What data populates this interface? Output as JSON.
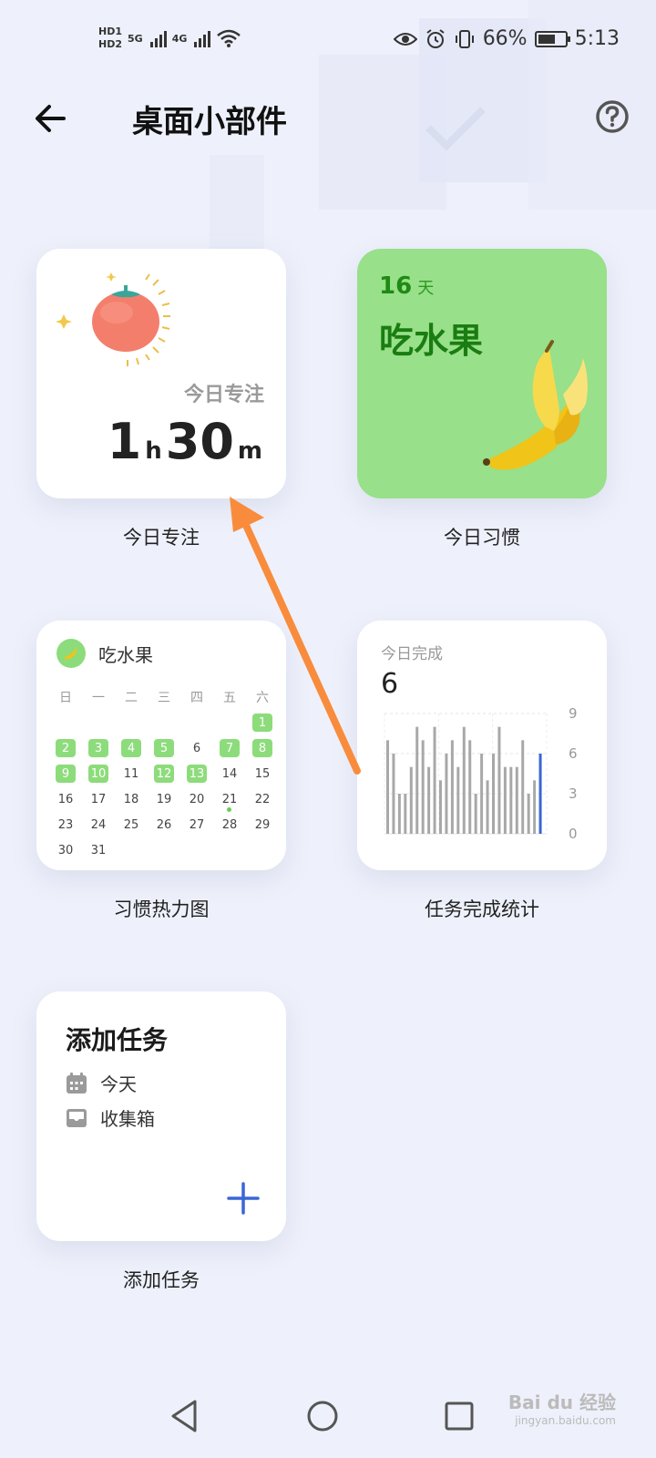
{
  "status_bar": {
    "hd1": "HD1",
    "hd2": "HD2",
    "net1": "5G",
    "net2": "4G",
    "battery_pct": "66%",
    "battery_level": 0.66,
    "time": "5:13",
    "icons": [
      "eye-icon",
      "alarm-icon",
      "vibrate-icon",
      "wifi-icon"
    ]
  },
  "header": {
    "title": "桌面小部件",
    "back_icon": "back-arrow-icon",
    "help_icon": "help-circle-icon"
  },
  "widgets": {
    "focus": {
      "label": "今日专注",
      "hours": "1",
      "hours_unit": "h",
      "minutes": "30",
      "minutes_unit": "m",
      "caption": "今日专注",
      "icon": "tomato-icon"
    },
    "habit": {
      "days": "16",
      "days_unit": "天",
      "name": "吃水果",
      "caption": "今日习惯",
      "icon": "banana-icon",
      "bg_color": "#98e089"
    },
    "heatmap": {
      "title": "吃水果",
      "caption": "习惯热力图",
      "weekdays": [
        "日",
        "一",
        "二",
        "三",
        "四",
        "五",
        "六"
      ],
      "weeks": [
        [
          "",
          "",
          "",
          "",
          "",
          "",
          "1"
        ],
        [
          "2",
          "3",
          "4",
          "5",
          "6",
          "7",
          "8"
        ],
        [
          "9",
          "10",
          "11",
          "12",
          "13",
          "14",
          "15"
        ],
        [
          "16",
          "17",
          "18",
          "19",
          "20",
          "21",
          "22"
        ],
        [
          "23",
          "24",
          "25",
          "26",
          "27",
          "28",
          "29"
        ],
        [
          "30",
          "31",
          "",
          "",
          "",
          "",
          ""
        ]
      ],
      "completed_days": [
        "1",
        "2",
        "3",
        "4",
        "5",
        "7",
        "8",
        "9",
        "10",
        "12",
        "13"
      ],
      "today": "21"
    },
    "stats": {
      "label": "今日完成",
      "value": "6",
      "caption": "任务完成统计",
      "y_ticks": [
        "9",
        "6",
        "3",
        "0"
      ]
    },
    "add_task": {
      "title": "添加任务",
      "items": [
        {
          "label": "今天",
          "icon": "calendar-icon"
        },
        {
          "label": "收集箱",
          "icon": "inbox-icon"
        }
      ],
      "caption": "添加任务",
      "plus_icon": "plus-icon"
    }
  },
  "watermark": {
    "text": "Bai du 经验",
    "sub": "jingyan.baidu.com"
  },
  "colors": {
    "accent_blue": "#3a66d6",
    "habit_green": "#98e089",
    "arrow_orange": "#f88c3c"
  },
  "chart_data": {
    "type": "bar",
    "title": "今日完成",
    "ylim": [
      0,
      9
    ],
    "y_ticks": [
      0,
      3,
      6,
      9
    ],
    "grid": true,
    "series": [
      {
        "values": [
          7,
          6,
          3,
          3,
          5,
          8,
          7,
          5,
          8,
          4,
          6,
          7,
          5,
          8,
          7,
          3,
          6,
          4,
          6,
          8,
          5,
          5,
          5,
          7,
          3,
          4,
          6
        ]
      }
    ],
    "highlight_last": true
  }
}
